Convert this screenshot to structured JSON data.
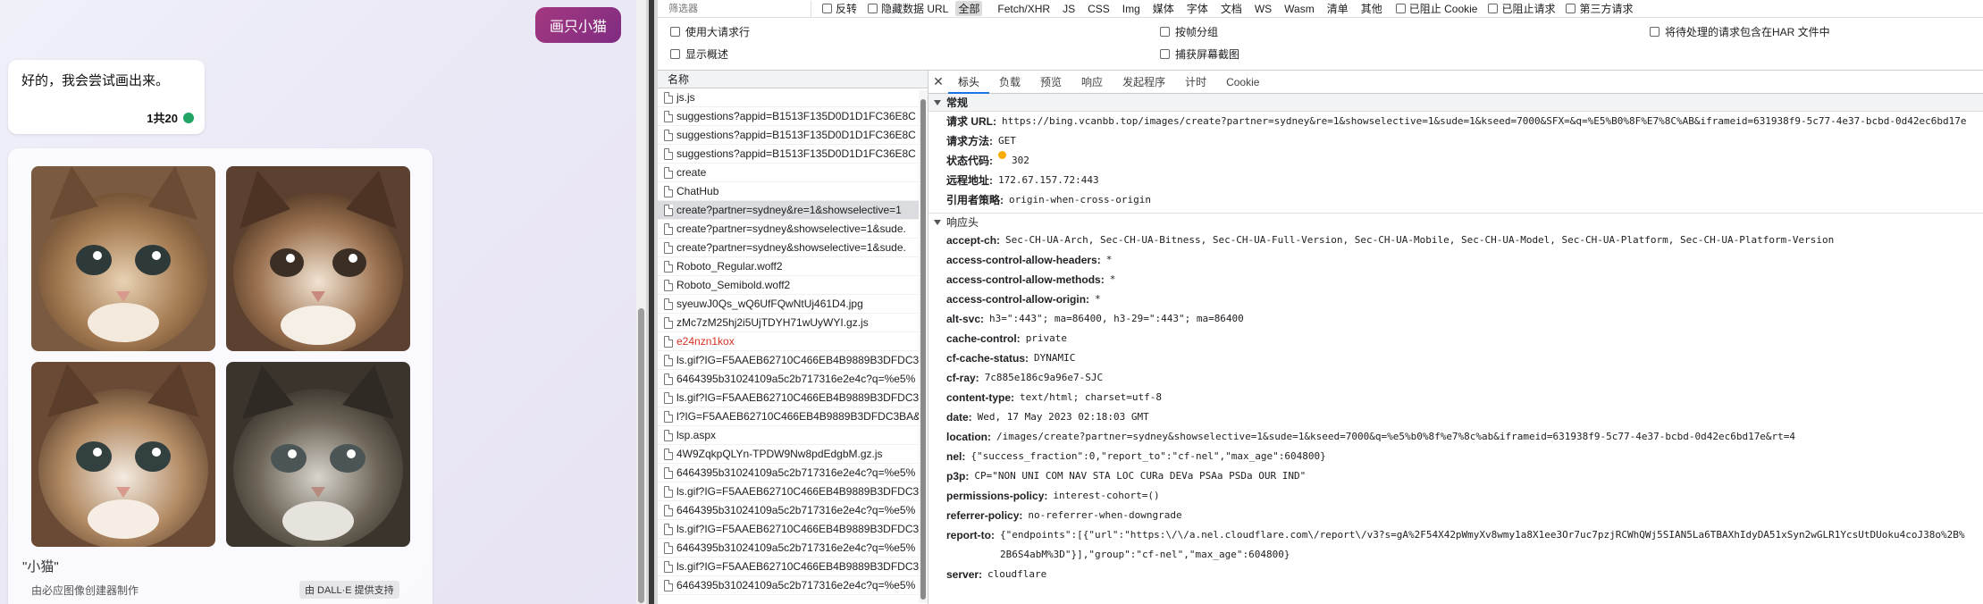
{
  "chat": {
    "user_message": "画只小猫",
    "bot_message": "好的，我会尝试画出来。",
    "bot_count": "1共20",
    "caption": "\"小猫\"",
    "made_by": "由必应图像创建器制作",
    "dalle_badge": "由 DALL·E 提供支持"
  },
  "toolbar": {
    "filter_placeholder": "筛选器",
    "invert_label": "反转",
    "hide_data_url_label": "隐藏数据 URL",
    "types": [
      "全部",
      "Fetch/XHR",
      "JS",
      "CSS",
      "Img",
      "媒体",
      "字体",
      "文档",
      "WS",
      "Wasm",
      "清单",
      "其他"
    ],
    "blocked_cookies_label": "已阻止 Cookie",
    "blocked_requests_label": "已阻止请求",
    "third_party_label": "第三方请求"
  },
  "options": {
    "large_rows": "使用大请求行",
    "group_by_frame": "按帧分组",
    "include_har": "将待处理的请求包含在HAR 文件中",
    "show_overview": "显示概述",
    "capture_screenshots": "捕获屏幕截图"
  },
  "request_list": {
    "header": "名称",
    "rows": [
      {
        "name": "js.js"
      },
      {
        "name": "suggestions?appid=B1513F135D0D1D1FC36E8C"
      },
      {
        "name": "suggestions?appid=B1513F135D0D1D1FC36E8C"
      },
      {
        "name": "suggestions?appid=B1513F135D0D1D1FC36E8C"
      },
      {
        "name": "create"
      },
      {
        "name": "ChatHub"
      },
      {
        "name": "create?partner=sydney&re=1&showselective=1"
      },
      {
        "name": "create?partner=sydney&showselective=1&sude."
      },
      {
        "name": "create?partner=sydney&showselective=1&sude."
      },
      {
        "name": "Roboto_Regular.woff2"
      },
      {
        "name": "Roboto_Semibold.woff2"
      },
      {
        "name": "syeuwJ0Qs_wQ6UfFQwNtUj461D4.jpg"
      },
      {
        "name": "zMc7zM25hj2i5UjTDYH71wUyWYI.gz.js"
      },
      {
        "name": "e24nzn1kox"
      },
      {
        "name": "ls.gif?IG=F5AAEB62710C466EB4B9889B3DFDC3B"
      },
      {
        "name": "6464395b31024109a5c2b717316e2e4c?q=%e5%"
      },
      {
        "name": "ls.gif?IG=F5AAEB62710C466EB4B9889B3DFDC3B"
      },
      {
        "name": "l?IG=F5AAEB62710C466EB4B9889B3DFDC3BA&."
      },
      {
        "name": "lsp.aspx"
      },
      {
        "name": "4W9ZqkpQLYn-TPDW9Nw8pdEdgbM.gz.js"
      },
      {
        "name": "6464395b31024109a5c2b717316e2e4c?q=%e5%"
      },
      {
        "name": "ls.gif?IG=F5AAEB62710C466EB4B9889B3DFDC3B"
      },
      {
        "name": "6464395b31024109a5c2b717316e2e4c?q=%e5%"
      },
      {
        "name": "ls.gif?IG=F5AAEB62710C466EB4B9889B3DFDC3B"
      },
      {
        "name": "6464395b31024109a5c2b717316e2e4c?q=%e5%"
      },
      {
        "name": "ls.gif?IG=F5AAEB62710C466EB4B9889B3DFDC3B"
      },
      {
        "name": "6464395b31024109a5c2b717316e2e4c?q=%e5%"
      }
    ]
  },
  "detail": {
    "tabs": [
      "标头",
      "负载",
      "预览",
      "响应",
      "发起程序",
      "计时",
      "Cookie"
    ],
    "general_title": "常规",
    "general": [
      {
        "k": "请求 URL:",
        "v": "https://bing.vcanbb.top/images/create?partner=sydney&re=1&showselective=1&sude=1&kseed=7000&SFX=&q=%E5%B0%8F%E7%8C%AB&iframeid=631938f9-5c77-4e37-bcbd-0d42ec6bd17e"
      },
      {
        "k": "请求方法:",
        "v": "GET"
      },
      {
        "k": "状态代码:",
        "v": "302"
      },
      {
        "k": "远程地址:",
        "v": "172.67.157.72:443"
      },
      {
        "k": "引用者策略:",
        "v": "origin-when-cross-origin"
      }
    ],
    "response_title": "响应头",
    "response": [
      {
        "k": "accept-ch:",
        "v": "Sec-CH-UA-Arch, Sec-CH-UA-Bitness, Sec-CH-UA-Full-Version, Sec-CH-UA-Mobile, Sec-CH-UA-Model, Sec-CH-UA-Platform, Sec-CH-UA-Platform-Version"
      },
      {
        "k": "access-control-allow-headers:",
        "v": "*"
      },
      {
        "k": "access-control-allow-methods:",
        "v": "*"
      },
      {
        "k": "access-control-allow-origin:",
        "v": "*"
      },
      {
        "k": "alt-svc:",
        "v": "h3=\":443\"; ma=86400, h3-29=\":443\"; ma=86400"
      },
      {
        "k": "cache-control:",
        "v": "private"
      },
      {
        "k": "cf-cache-status:",
        "v": "DYNAMIC"
      },
      {
        "k": "cf-ray:",
        "v": "7c885e186c9a96e7-SJC"
      },
      {
        "k": "content-type:",
        "v": "text/html; charset=utf-8"
      },
      {
        "k": "date:",
        "v": "Wed, 17 May 2023 02:18:03 GMT"
      },
      {
        "k": "location:",
        "v": "/images/create?partner=sydney&showselective=1&sude=1&kseed=7000&q=%e5%b0%8f%e7%8c%ab&iframeid=631938f9-5c77-4e37-bcbd-0d42ec6bd17e&rt=4"
      },
      {
        "k": "nel:",
        "v": "{\"success_fraction\":0,\"report_to\":\"cf-nel\",\"max_age\":604800}"
      },
      {
        "k": "p3p:",
        "v": "CP=\"NON UNI COM NAV STA LOC CURa DEVa PSAa PSDa OUR IND\""
      },
      {
        "k": "permissions-policy:",
        "v": "interest-cohort=()"
      },
      {
        "k": "referrer-policy:",
        "v": "no-referrer-when-downgrade"
      },
      {
        "k": "report-to:",
        "v": "{\"endpoints\":[{\"url\":\"https:\\/\\/a.nel.cloudflare.com\\/report\\/v3?s=gA%2F54X42pWmyXv8wmy1a8X1ee3Or7uc7pzjRCWhQWj5SIAN5La6TBAXhIdyDA51xSyn2wGLR1YcsUtDUoku4coJ38o%2B%2B6S4abM%3D\"}],\"group\":\"cf-nel\",\"max_age\":604800}"
      },
      {
        "k": "server:",
        "v": "cloudflare"
      }
    ]
  }
}
